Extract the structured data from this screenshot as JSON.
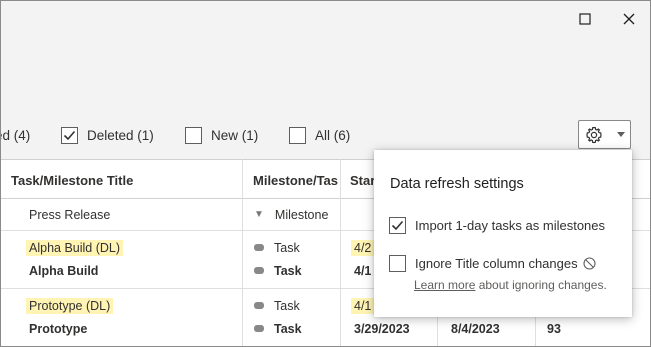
{
  "window": {
    "maximize_icon": "maximize-icon",
    "close_icon": "close-icon"
  },
  "filters": [
    {
      "label": "ed (4)",
      "checked": true
    },
    {
      "label": "Deleted (1)",
      "checked": true
    },
    {
      "label": "New (1)",
      "checked": false
    },
    {
      "label": "All (6)",
      "checked": false
    }
  ],
  "settings_button": {
    "icon": "gear-icon",
    "dropdown_icon": "chevron-down-icon"
  },
  "grid": {
    "headers": [
      "Task/Milestone Title",
      "Milestone/Tas",
      "Star"
    ],
    "rows": [
      {
        "title": "Press Release",
        "type": "Milestone",
        "start": "",
        "end": "",
        "extra": ""
      },
      {
        "title": "Alpha Build (DL)",
        "type": "Task",
        "start": "4/2",
        "end": "",
        "extra": "",
        "highlight": true
      },
      {
        "title": "Alpha Build",
        "type": "Task",
        "start": "4/1",
        "end": "",
        "extra": ""
      },
      {
        "title": "Prototype (DL)",
        "type": "Task",
        "start": "4/1",
        "end": "",
        "extra": "",
        "highlight": true
      },
      {
        "title": "Prototype",
        "type": "Task",
        "start": "3/29/2023",
        "end": "8/4/2023",
        "extra": "93"
      }
    ]
  },
  "popup": {
    "title": "Data refresh settings",
    "import_milestones_label": "Import 1-day tasks as milestones",
    "import_milestones_checked": true,
    "ignore_title_label": "Ignore Title column changes",
    "ignore_title_checked": false,
    "learn_more_link": "Learn more",
    "learn_more_suffix": " about ignoring changes."
  }
}
